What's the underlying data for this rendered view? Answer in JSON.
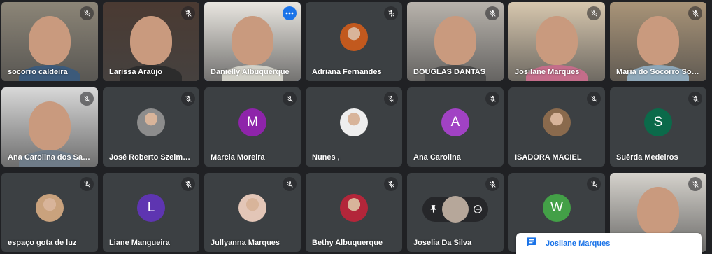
{
  "colors": {
    "speaking_outline": "#8ab4f8",
    "tile_bg": "#3c4043",
    "accent": "#1a73e8"
  },
  "participants": [
    {
      "name": "socorro caldeira",
      "type": "video",
      "muted": true,
      "bg": "#8c8577",
      "shirt": "#3c5a7a"
    },
    {
      "name": "Larissa Araújo",
      "type": "video",
      "muted": true,
      "bg": "#4a3a32",
      "shirt": "#2c2c2c"
    },
    {
      "name": "Danielly Albuquerque",
      "type": "video",
      "muted": false,
      "speaking": true,
      "more": true,
      "bg": "#e9e6e0",
      "shirt": "#d0cfc6"
    },
    {
      "name": "Adriana Fernandes",
      "type": "avatar-photo",
      "muted": true,
      "avatar_color": "#c2591e"
    },
    {
      "name": "DOUGLAS DANTAS",
      "type": "video",
      "muted": true,
      "bg": "#b8b3ac",
      "shirt": "#4a4a4a"
    },
    {
      "name": "Josilane Marques",
      "type": "video",
      "muted": true,
      "bg": "#d7c7ae",
      "shirt": "#c46d8a"
    },
    {
      "name": "Maria do Socorro Sousa",
      "type": "video",
      "muted": true,
      "bg": "#a99478",
      "shirt": "#8ea7b8"
    },
    {
      "name": "Ana Carolina dos Santos",
      "type": "video",
      "muted": true,
      "bg": "#d8d8d8",
      "shirt": "#6f7c89"
    },
    {
      "name": "José Roberto Szelmeczy",
      "type": "avatar-photo",
      "muted": true,
      "avatar_color": "#8c8c8c"
    },
    {
      "name": "Marcia Moreira",
      "type": "avatar",
      "initial": "M",
      "muted": true,
      "avatar_color": "#8e24aa"
    },
    {
      "name": "Nunes ,",
      "type": "avatar-photo",
      "muted": true,
      "avatar_color": "#eeeeee"
    },
    {
      "name": "Ana Carolina",
      "type": "avatar",
      "initial": "A",
      "muted": true,
      "avatar_color": "#a142c4"
    },
    {
      "name": "ISADORA MACIEL",
      "type": "avatar-photo",
      "muted": true,
      "avatar_color": "#8a6a4d"
    },
    {
      "name": "Suêrda Medeiros",
      "type": "avatar",
      "initial": "S",
      "muted": true,
      "avatar_color": "#0b6a4a"
    },
    {
      "name": "espaço gota de luz",
      "type": "avatar-photo",
      "muted": true,
      "avatar_color": "#c9a27d"
    },
    {
      "name": "Liane Mangueira",
      "type": "avatar",
      "initial": "L",
      "muted": true,
      "avatar_color": "#5e35b1"
    },
    {
      "name": "Jullyanna Marques",
      "type": "avatar-photo",
      "muted": true,
      "avatar_color": "#e3c6b7"
    },
    {
      "name": "Bethy Albuquerque",
      "type": "avatar-photo",
      "muted": true,
      "avatar_color": "#b3263a"
    },
    {
      "name": "Joselia Da Silva",
      "type": "hover",
      "muted": true,
      "avatar_color": "#b6a79a"
    },
    {
      "name": "",
      "type": "avatar",
      "initial": "W",
      "muted": true,
      "avatar_color": "#43a047"
    },
    {
      "name": "",
      "type": "video",
      "muted": true,
      "bg": "#d5d2cc",
      "shirt": "#4b5a3c"
    }
  ],
  "popup": {
    "text": "Josilane Marques",
    "icon": "chat-icon"
  }
}
